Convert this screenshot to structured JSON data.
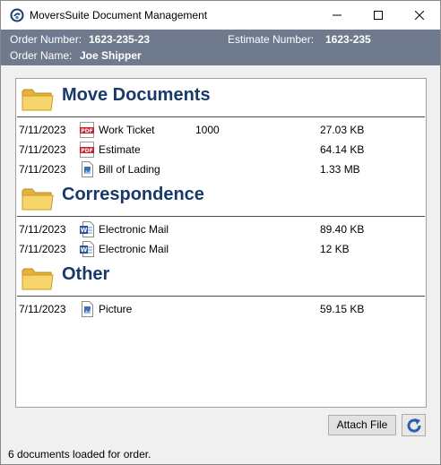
{
  "window": {
    "title": "MoversSuite Document Management",
    "icon": "moverssuite-logo-icon",
    "controls": [
      "minimize-icon",
      "maximize-icon",
      "close-icon"
    ]
  },
  "order": {
    "order_number_label": "Order Number:",
    "order_number": "1623-235-23",
    "estimate_number_label": "Estimate Number:",
    "estimate_number": "1623-235",
    "order_name_label": "Order Name:",
    "order_name": "Joe Shipper"
  },
  "sections": [
    {
      "title": "Move Documents",
      "icon": "folder-icon",
      "documents": [
        {
          "date": "7/11/2023",
          "icon": "pdf-icon",
          "name": "Work Ticket",
          "number": "1000",
          "size": "27.03 KB"
        },
        {
          "date": "7/11/2023",
          "icon": "pdf-icon",
          "name": "Estimate",
          "number": "",
          "size": "64.14 KB"
        },
        {
          "date": "7/11/2023",
          "icon": "image-file-icon",
          "name": "Bill of Lading",
          "number": "",
          "size": "1.33 MB"
        }
      ]
    },
    {
      "title": "Correspondence",
      "icon": "folder-icon",
      "documents": [
        {
          "date": "7/11/2023",
          "icon": "word-doc-icon",
          "name": "Electronic Mail",
          "number": "",
          "size": "89.40 KB"
        },
        {
          "date": "7/11/2023",
          "icon": "word-doc-icon",
          "name": "Electronic Mail",
          "number": "",
          "size": "12 KB"
        }
      ]
    },
    {
      "title": "Other",
      "icon": "folder-icon",
      "documents": [
        {
          "date": "7/11/2023",
          "icon": "image-file-icon",
          "name": "Picture",
          "number": "",
          "size": "59.15 KB"
        }
      ]
    }
  ],
  "actions": {
    "attach_label": "Attach File",
    "refresh_icon": "refresh-icon"
  },
  "status": {
    "text": "6 documents loaded for order."
  },
  "colors": {
    "header_band": "#707a8e",
    "section_title": "#173a6b",
    "pdf_red": "#c8202a",
    "word_blue": "#2b579a",
    "folder_yellow": "#f4c84a"
  }
}
